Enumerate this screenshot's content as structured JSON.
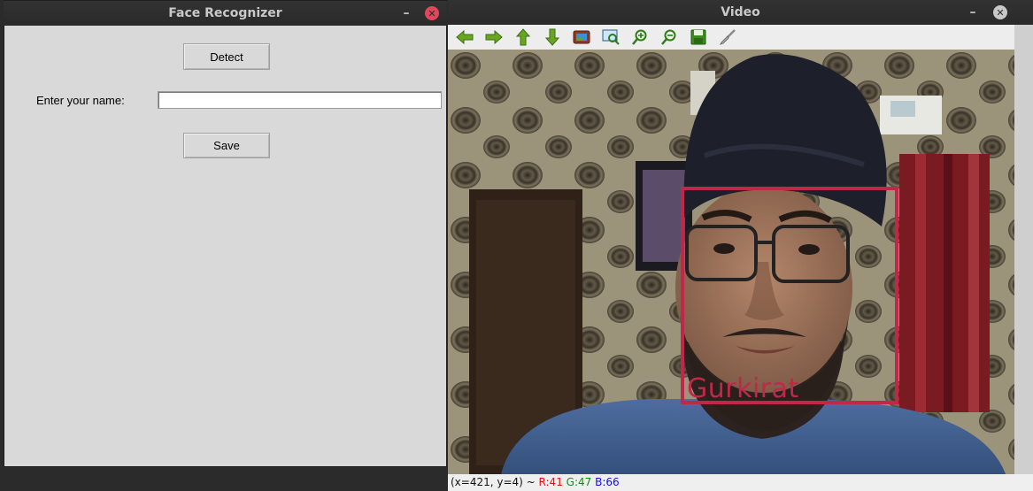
{
  "face_window": {
    "title": "Face Recognizer",
    "detect_label": "Detect",
    "name_label": "Enter your name:",
    "name_value": "",
    "save_label": "Save"
  },
  "video_window": {
    "title": "Video",
    "toolbar": [
      "arrow-left-icon",
      "arrow-right-icon",
      "arrow-up-icon",
      "arrow-down-icon",
      "image-icon",
      "zoom-select-icon",
      "zoom-in-icon",
      "zoom-out-icon",
      "save-icon",
      "brush-icon"
    ],
    "face_label": "Gurkirat",
    "status": {
      "coords": "(x=421, y=4) ~",
      "r": "R:41",
      "g": "G:47",
      "b": "B:66"
    }
  },
  "colors": {
    "face_box": "#c0284a",
    "status_r": "#e01010",
    "status_g": "#1a8a1a",
    "status_b": "#1010e0"
  }
}
